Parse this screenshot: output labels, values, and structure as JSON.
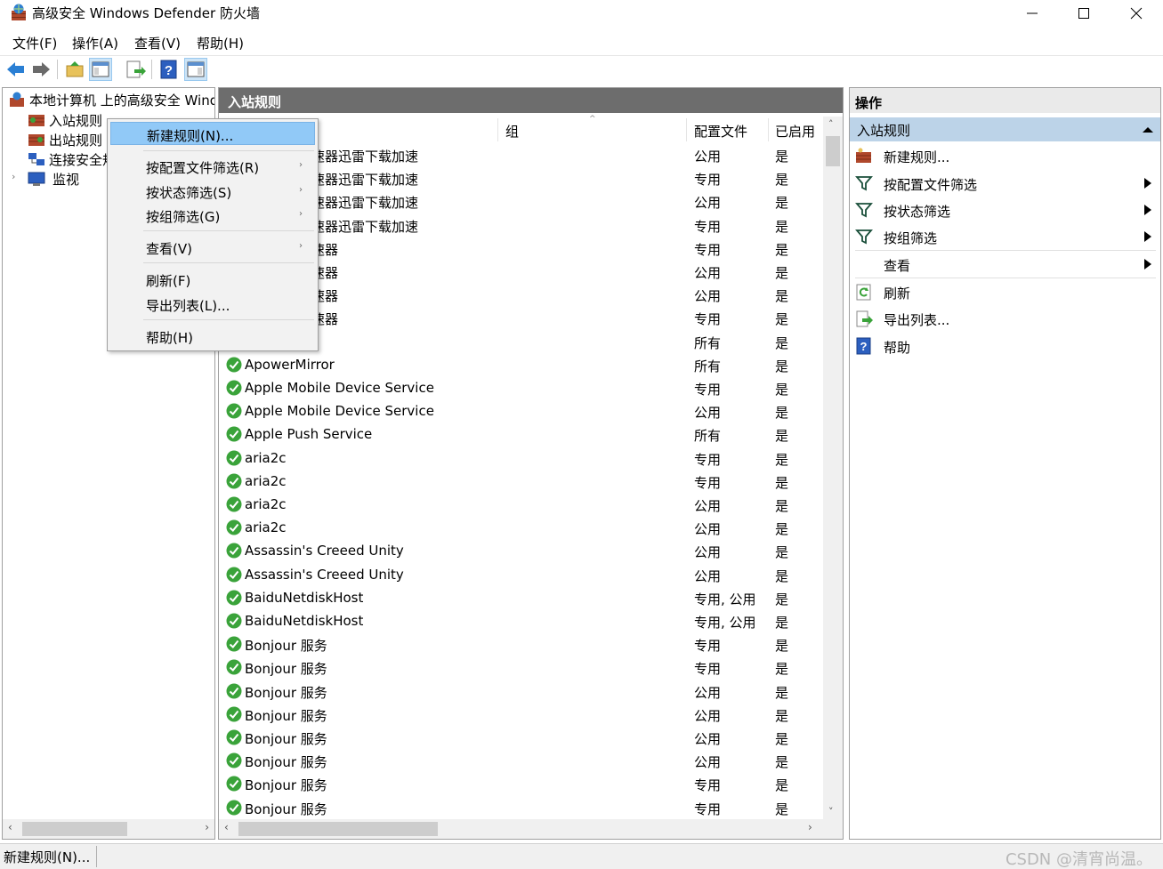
{
  "window": {
    "title": "高级安全 Windows Defender 防火墙"
  },
  "menubar": {
    "items": [
      "文件(F)",
      "操作(A)",
      "查看(V)",
      "帮助(H)"
    ]
  },
  "toolbar": {
    "buttons": [
      "back-icon",
      "forward-icon",
      "up-folder-icon",
      "console-tree-icon",
      "export-icon",
      "help-icon",
      "action-pane-icon"
    ]
  },
  "tree": {
    "root_label": "本地计算机 上的高级安全 Windows Defender 防火墙",
    "items": [
      {
        "label": "入站规则",
        "icon": "inbound-rules-icon"
      },
      {
        "label": "出站规则",
        "icon": "outbound-rules-icon"
      },
      {
        "label": "连接安全规则",
        "icon": "connection-security-icon"
      },
      {
        "label": "监视",
        "icon": "monitor-icon"
      }
    ]
  },
  "center": {
    "header": "入站规则",
    "columns": {
      "group": "组",
      "profile": "配置文件",
      "enabled": "已启用"
    },
    "rows": [
      {
        "name": "迅雷下载加速器迅雷下载加速",
        "profile": "公用",
        "enabled": "是"
      },
      {
        "name": "迅雷下载加速器迅雷下载加速",
        "profile": "专用",
        "enabled": "是"
      },
      {
        "name": "迅雷下载加速器迅雷下载加速",
        "profile": "公用",
        "enabled": "是"
      },
      {
        "name": "迅雷下载加速器迅雷下载加速",
        "profile": "专用",
        "enabled": "是"
      },
      {
        "name": "迅雷下载加速器",
        "profile": "专用",
        "enabled": "是"
      },
      {
        "name": "迅雷下载加速器",
        "profile": "公用",
        "enabled": "是"
      },
      {
        "name": "迅雷下载加速器",
        "profile": "公用",
        "enabled": "是"
      },
      {
        "name": "迅雷下载加速器",
        "profile": "专用",
        "enabled": "是"
      },
      {
        "name": "",
        "profile": "所有",
        "enabled": "是"
      },
      {
        "name": "ApowerMirror",
        "profile": "所有",
        "enabled": "是"
      },
      {
        "name": "Apple Mobile Device Service",
        "profile": "专用",
        "enabled": "是"
      },
      {
        "name": "Apple Mobile Device Service",
        "profile": "公用",
        "enabled": "是"
      },
      {
        "name": "Apple Push Service",
        "profile": "所有",
        "enabled": "是"
      },
      {
        "name": "aria2c",
        "profile": "专用",
        "enabled": "是"
      },
      {
        "name": "aria2c",
        "profile": "专用",
        "enabled": "是"
      },
      {
        "name": "aria2c",
        "profile": "公用",
        "enabled": "是"
      },
      {
        "name": "aria2c",
        "profile": "公用",
        "enabled": "是"
      },
      {
        "name": "Assassin's Creeed Unity",
        "profile": "公用",
        "enabled": "是"
      },
      {
        "name": "Assassin's Creeed Unity",
        "profile": "公用",
        "enabled": "是"
      },
      {
        "name": "BaiduNetdiskHost",
        "profile": "专用, 公用",
        "enabled": "是"
      },
      {
        "name": "BaiduNetdiskHost",
        "profile": "专用, 公用",
        "enabled": "是"
      },
      {
        "name": "Bonjour 服务",
        "profile": "专用",
        "enabled": "是"
      },
      {
        "name": "Bonjour 服务",
        "profile": "专用",
        "enabled": "是"
      },
      {
        "name": "Bonjour 服务",
        "profile": "公用",
        "enabled": "是"
      },
      {
        "name": "Bonjour 服务",
        "profile": "公用",
        "enabled": "是"
      },
      {
        "name": "Bonjour 服务",
        "profile": "公用",
        "enabled": "是"
      },
      {
        "name": "Bonjour 服务",
        "profile": "公用",
        "enabled": "是"
      },
      {
        "name": "Bonjour 服务",
        "profile": "专用",
        "enabled": "是"
      },
      {
        "name": "Bonjour 服务",
        "profile": "专用",
        "enabled": "是"
      }
    ]
  },
  "context_menu": {
    "items": [
      {
        "label": "新建规则(N)...",
        "submenu": false,
        "highlighted": true
      },
      {
        "label": "按配置文件筛选(R)",
        "submenu": true
      },
      {
        "label": "按状态筛选(S)",
        "submenu": true
      },
      {
        "label": "按组筛选(G)",
        "submenu": true
      },
      {
        "label": "查看(V)",
        "submenu": true
      },
      {
        "label": "刷新(F)",
        "submenu": false
      },
      {
        "label": "导出列表(L)...",
        "submenu": false
      },
      {
        "label": "帮助(H)",
        "submenu": false
      }
    ]
  },
  "actions": {
    "header": "操作",
    "section": "入站规则",
    "items": [
      {
        "label": "新建规则...",
        "icon": "new-rule-icon",
        "submenu": false
      },
      {
        "label": "按配置文件筛选",
        "icon": "filter-icon",
        "submenu": true
      },
      {
        "label": "按状态筛选",
        "icon": "filter-icon",
        "submenu": true
      },
      {
        "label": "按组筛选",
        "icon": "filter-icon",
        "submenu": true
      },
      {
        "label": "查看",
        "icon": "",
        "submenu": true
      },
      {
        "label": "刷新",
        "icon": "refresh-icon",
        "submenu": false
      },
      {
        "label": "导出列表...",
        "icon": "export-list-icon",
        "submenu": false
      },
      {
        "label": "帮助",
        "icon": "help-icon",
        "submenu": false
      }
    ]
  },
  "statusbar": {
    "text": "新建规则(N)...",
    "watermark": "CSDN @清宵尚温。"
  },
  "colors": {
    "center_header_bg": "#6d6d6d",
    "menu_highlight": "#91c9f7",
    "actions_section_bg": "#bcd3e8",
    "check_green": "#3aa33a"
  }
}
